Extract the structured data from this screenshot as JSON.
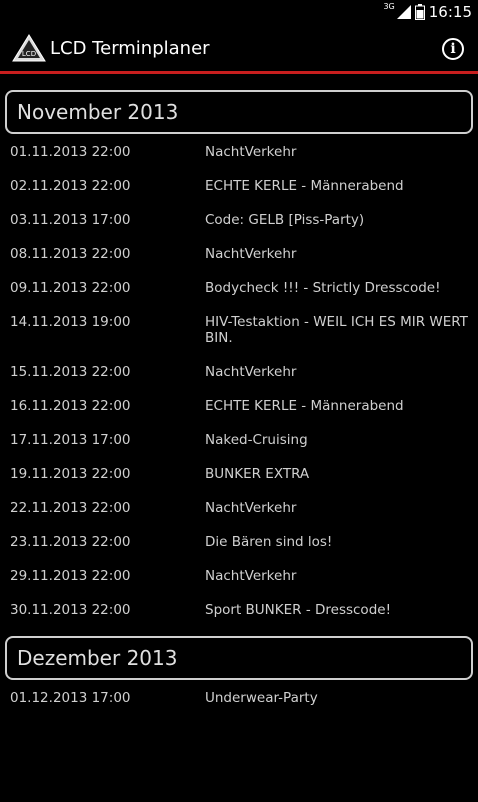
{
  "status": {
    "network": "3G",
    "time": "16:15"
  },
  "app": {
    "title": "LCD Terminplaner",
    "logo_text": "LCD"
  },
  "months": [
    {
      "name": "November 2013",
      "events": [
        {
          "date": "01.11.2013 22:00",
          "title": "NachtVerkehr"
        },
        {
          "date": "02.11.2013 22:00",
          "title": "ECHTE KERLE - Männerabend"
        },
        {
          "date": "03.11.2013 17:00",
          "title": "Code: GELB [Piss-Party)"
        },
        {
          "date": "08.11.2013 22:00",
          "title": "NachtVerkehr"
        },
        {
          "date": "09.11.2013 22:00",
          "title": "Bodycheck !!! - Strictly Dresscode!"
        },
        {
          "date": "14.11.2013 19:00",
          "title": "HIV-Testaktion - WEIL ICH ES MIR WERT BIN."
        },
        {
          "date": "15.11.2013 22:00",
          "title": "NachtVerkehr"
        },
        {
          "date": "16.11.2013 22:00",
          "title": "ECHTE KERLE - Männerabend"
        },
        {
          "date": "17.11.2013 17:00",
          "title": "Naked-Cruising"
        },
        {
          "date": "19.11.2013 22:00",
          "title": "BUNKER EXTRA"
        },
        {
          "date": "22.11.2013 22:00",
          "title": "NachtVerkehr"
        },
        {
          "date": "23.11.2013 22:00",
          "title": "Die Bären sind los!"
        },
        {
          "date": "29.11.2013 22:00",
          "title": "NachtVerkehr"
        },
        {
          "date": "30.11.2013 22:00",
          "title": "Sport BUNKER - Dresscode!"
        }
      ]
    },
    {
      "name": "Dezember 2013",
      "events": [
        {
          "date": "01.12.2013 17:00",
          "title": "Underwear-Party"
        }
      ]
    }
  ]
}
